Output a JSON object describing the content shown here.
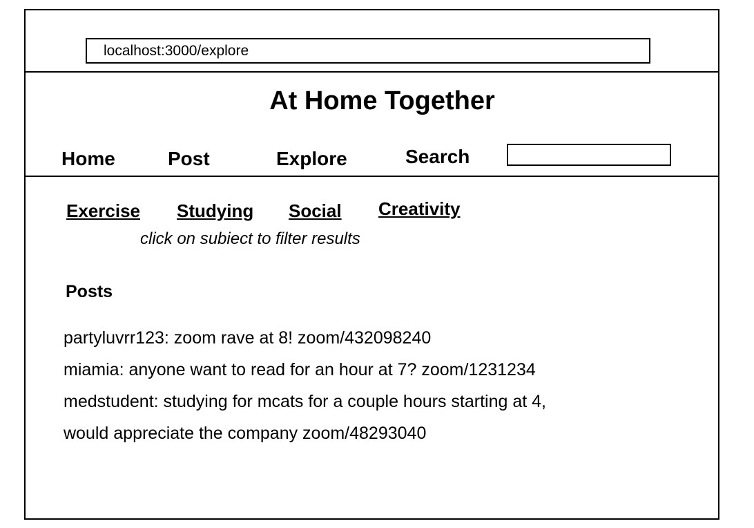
{
  "browser": {
    "url": "localhost:3000/explore"
  },
  "header": {
    "title": "At Home Together"
  },
  "nav": {
    "home": "Home",
    "post": "Post",
    "explore": "Explore",
    "search": "Search",
    "search_value": ""
  },
  "filters": {
    "subjects": [
      "Exercise",
      "Studying",
      "Social",
      "Creativity"
    ],
    "hint": "click on subiect to filter results"
  },
  "posts": {
    "heading": "Posts",
    "lines": [
      "partyluvrr123: zoom rave at 8! zoom/432098240",
      "miamia: anyone want to read for an hour at 7? zoom/1231234",
      "medstudent: studying for mcats for a couple hours starting at 4,",
      "would appreciate the company  zoom/48293040"
    ]
  }
}
